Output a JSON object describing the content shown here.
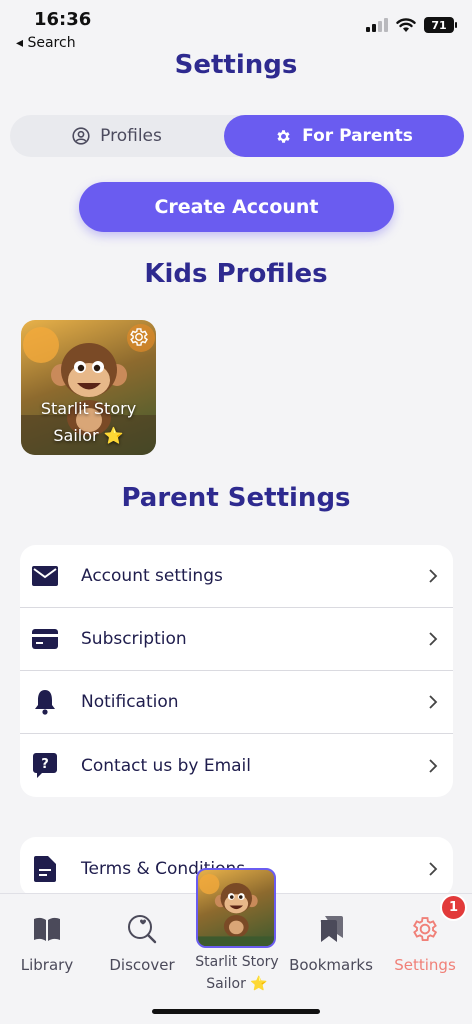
{
  "status": {
    "time": "16:36",
    "back_label": "◂ Search",
    "battery": "71"
  },
  "header": {
    "title": "Settings"
  },
  "segments": {
    "profiles": "Profiles",
    "for_parents": "For Parents"
  },
  "actions": {
    "create_account": "Create Account"
  },
  "kids_profiles": {
    "title": "Kids Profiles",
    "profiles": [
      {
        "name_line1": "Starlit Story",
        "name_line2": "Sailor ⭐"
      }
    ]
  },
  "parent_settings": {
    "title": "Parent Settings",
    "items": [
      {
        "label": "Account settings",
        "icon": "envelope-icon"
      },
      {
        "label": "Subscription",
        "icon": "credit-card-icon"
      },
      {
        "label": "Notification",
        "icon": "bell-icon"
      },
      {
        "label": "Contact us by Email",
        "icon": "question-bubble-icon"
      }
    ],
    "more_items": [
      {
        "label": "Terms & Conditions",
        "icon": "document-icon"
      }
    ]
  },
  "tabbar": {
    "library": "Library",
    "discover": "Discover",
    "profile_line1": "Starlit Story",
    "profile_line2": "Sailor ⭐",
    "bookmarks": "Bookmarks",
    "settings": "Settings",
    "settings_badge": "1"
  },
  "colors": {
    "accent": "#6a5cf0",
    "title": "#2e2a8f",
    "active_tab": "#f08078",
    "badge": "#e23a3a"
  }
}
